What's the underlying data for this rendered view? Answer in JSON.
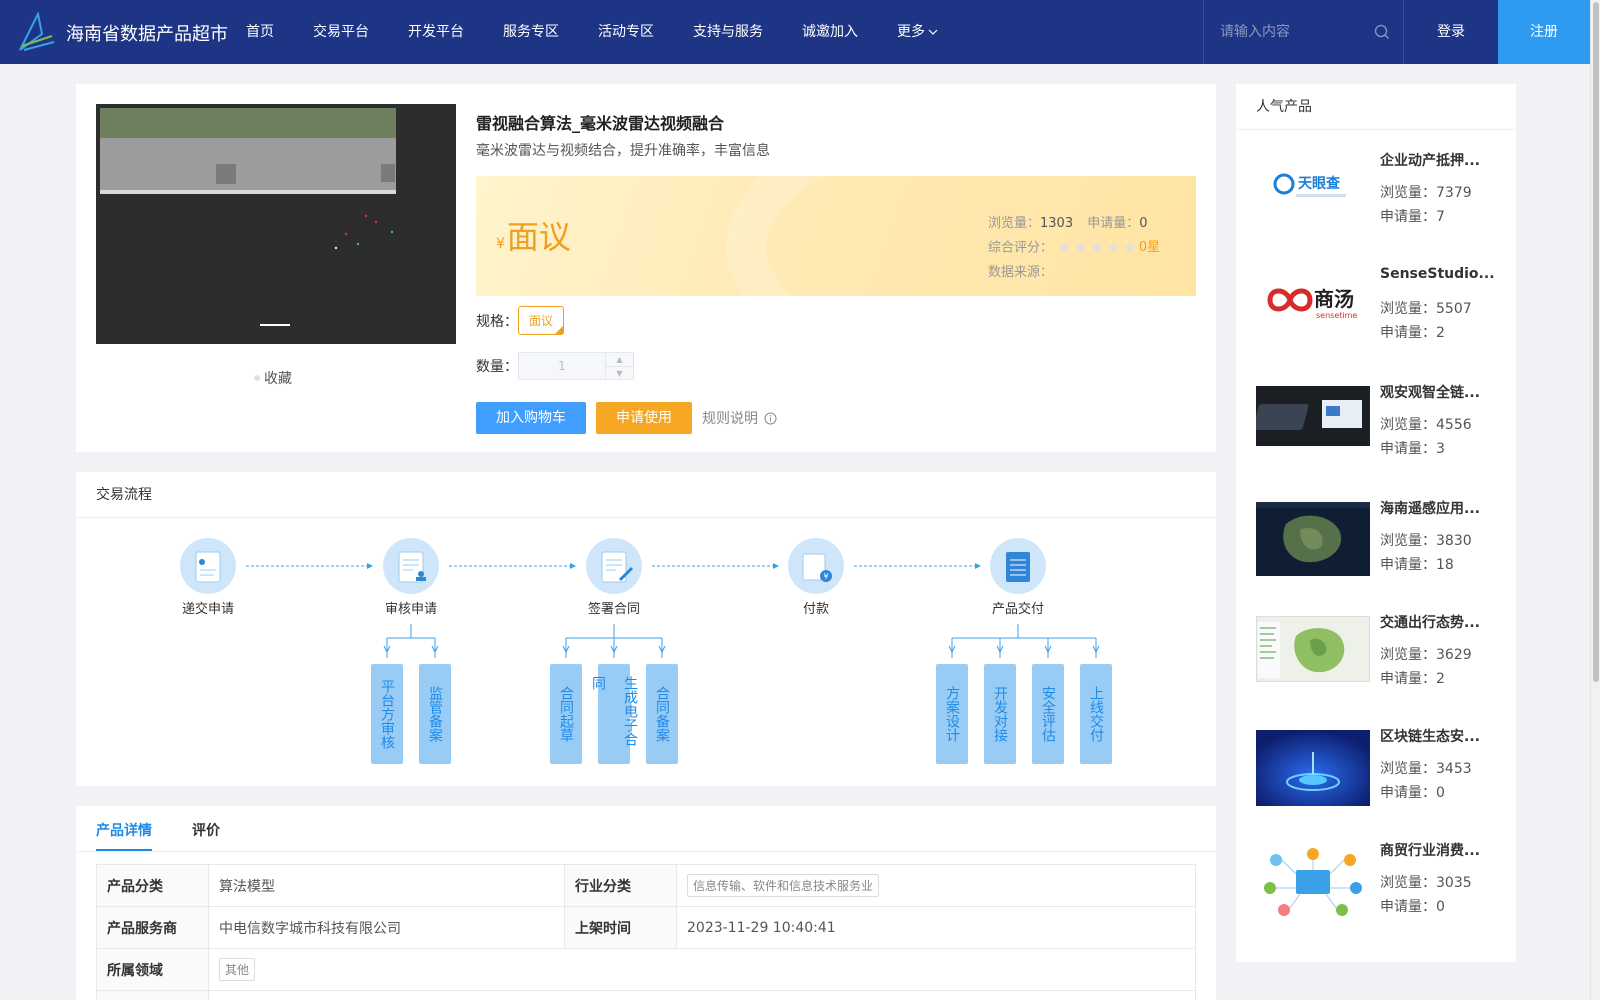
{
  "header": {
    "site_title": "海南省数据产品超市",
    "nav": [
      "首页",
      "交易平台",
      "开发平台",
      "服务专区",
      "活动专区",
      "支持与服务",
      "诚邀加入"
    ],
    "nav_more": "更多",
    "search_placeholder": "请输入内容",
    "login": "登录",
    "register": "注册"
  },
  "product": {
    "title": "雷视融合算法_毫米波雷达视频融合",
    "desc": "毫米波雷达与视频结合，提升准确率，丰富信息",
    "favorite": "收藏",
    "price_symbol": "¥",
    "price": "面议",
    "views_label": "浏览量：",
    "views": "1303",
    "applies_label": "申请量：",
    "applies": "0",
    "rating_label": "综合评分：",
    "rating_text": "0星",
    "rating_value": 0,
    "source_label": "数据来源：",
    "spec_label": "规格：",
    "spec_value": "面议",
    "qty_label": "数量：",
    "qty_value": "1",
    "add_cart": "加入购物车",
    "apply": "申请使用",
    "rules": "规则说明"
  },
  "flow": {
    "title": "交易流程",
    "steps": [
      "递交申请",
      "审核申请",
      "签署合同",
      "付款",
      "产品交付"
    ],
    "sub_steps": {
      "review": [
        "平台方审核",
        "监管备案"
      ],
      "contract": [
        "合同起草",
        "生成电子合同",
        "合同备案"
      ],
      "delivery": [
        "方案设计",
        "开发对接",
        "安全评估",
        "上线交付"
      ]
    }
  },
  "details": {
    "tabs": [
      "产品详情",
      "评价"
    ],
    "rows": [
      {
        "k1": "产品分类",
        "v1": "算法模型",
        "k2": "行业分类",
        "v2": "信息传输、软件和信息技术服务业"
      },
      {
        "k1": "产品服务商",
        "v1": "中电信数字城市科技有限公司",
        "k2": "上架时间",
        "v2": "2023-11-29 10:40:41"
      },
      {
        "k1": "所属领域",
        "v1": "其他"
      }
    ]
  },
  "popular": {
    "title": "人气产品",
    "views_label": "浏览量：",
    "applies_label": "申请量：",
    "items": [
      {
        "name": "企业动产抵押...",
        "views": "7379",
        "applies": "7",
        "thumb": "tianyancha-logo"
      },
      {
        "name": "SenseStudio...",
        "views": "5507",
        "applies": "2",
        "thumb": "sensetime-logo"
      },
      {
        "name": "观安观智全链...",
        "views": "4556",
        "applies": "3",
        "thumb": "device-photo"
      },
      {
        "name": "海南遥感应用...",
        "views": "3830",
        "applies": "18",
        "thumb": "satellite-map"
      },
      {
        "name": "交通出行态势...",
        "views": "3629",
        "applies": "2",
        "thumb": "traffic-map"
      },
      {
        "name": "区块链生态安...",
        "views": "3453",
        "applies": "0",
        "thumb": "blockchain-art"
      },
      {
        "name": "商贸行业消费...",
        "views": "3035",
        "applies": "0",
        "thumb": "commerce-illustration"
      }
    ],
    "thumb_logo_texts": [
      "天眼查",
      "商汤",
      "sensetime"
    ]
  },
  "colors": {
    "header_bg": "#1e3585",
    "primary": "#409eff",
    "accent": "#f5a623",
    "register_bg": "#2f9bf0"
  }
}
